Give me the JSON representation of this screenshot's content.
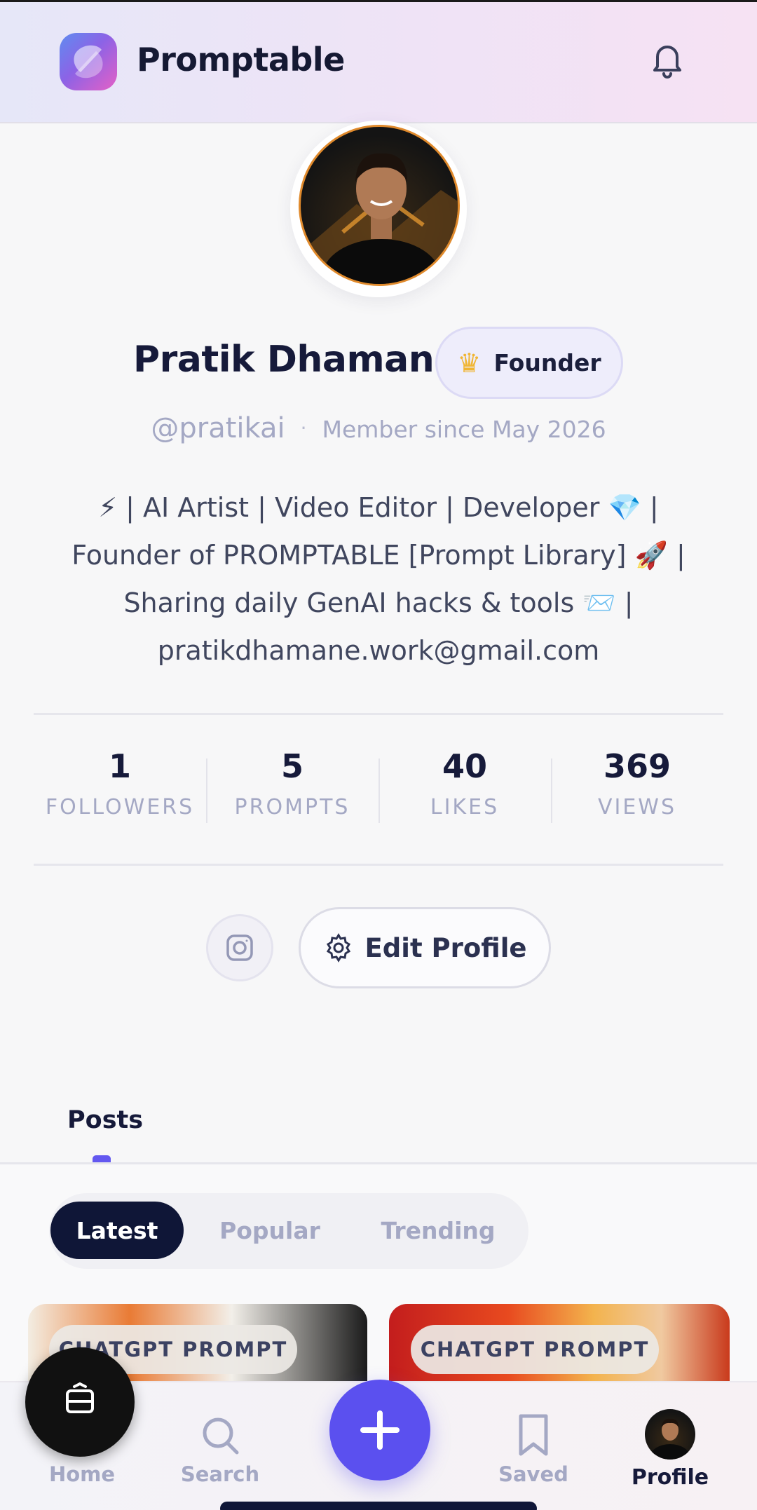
{
  "app": {
    "name": "Promptable"
  },
  "profile": {
    "name": "Pratik Dhamane",
    "badge": "Founder",
    "handle": "@pratikai",
    "separator": "·",
    "member_since": "Member since May 2026",
    "bio_lines": [
      "⚡ | AI Artist | Video Editor | Developer 💎 |",
      "Founder of PROMPTABLE [Prompt Library] 🚀 |",
      "Sharing daily GenAI hacks & tools 📨 |",
      "pratikdhamane.work@gmail.com"
    ]
  },
  "stats": [
    {
      "value": "1",
      "label": "FOLLOWERS"
    },
    {
      "value": "5",
      "label": "PROMPTS"
    },
    {
      "value": "40",
      "label": "LIKES"
    },
    {
      "value": "369",
      "label": "VIEWS"
    }
  ],
  "actions": {
    "edit_profile": "Edit Profile"
  },
  "tabs": {
    "posts": "Posts"
  },
  "filters": [
    {
      "label": "Latest",
      "active": true
    },
    {
      "label": "Popular",
      "active": false
    },
    {
      "label": "Trending",
      "active": false
    }
  ],
  "posts": [
    {
      "tag": "CHATGPT PROMPT"
    },
    {
      "tag": "CHATGPT PROMPT"
    }
  ],
  "nav": {
    "home": "Home",
    "search": "Search",
    "saved": "Saved",
    "profile": "Profile"
  },
  "colors": {
    "accent": "#5b50ef",
    "dark": "#0f1637",
    "muted": "#a4a8c4"
  }
}
